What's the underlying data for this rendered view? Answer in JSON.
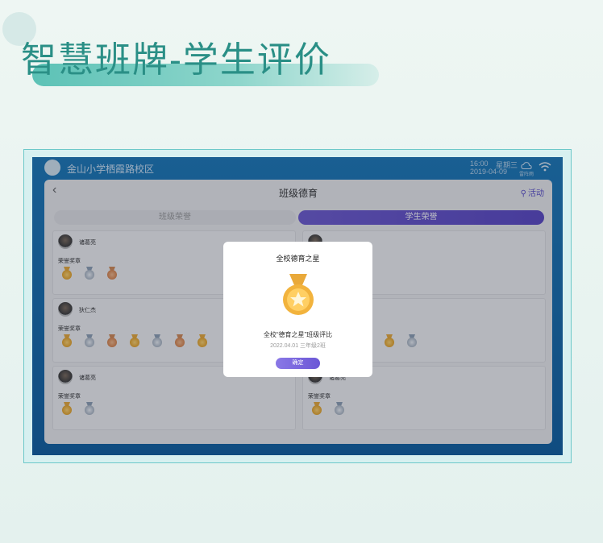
{
  "page": {
    "title": "智慧班牌-学生评价"
  },
  "topbar": {
    "school": "金山小学栖霞路校区",
    "time": "16:00",
    "date": "2019-04-09",
    "weekday": "星期三",
    "cloud_label": "雷阵雨"
  },
  "panel": {
    "title": "班级德育",
    "back_icon": "chevron-left",
    "activity_label": "活动",
    "tabs": [
      {
        "label": "班级荣誉",
        "active": false
      },
      {
        "label": "学生荣誉",
        "active": true
      }
    ]
  },
  "cards": [
    {
      "name": "诸葛亮",
      "label": "荣誉奖章",
      "medals": [
        "gold",
        "silver",
        "bronze"
      ]
    },
    {
      "name": "",
      "label": "",
      "medals": []
    },
    {
      "name": "狄仁杰",
      "label": "荣誉奖章",
      "medals": [
        "gold",
        "silver",
        "bronze",
        "gold",
        "silver",
        "bronze",
        "gold"
      ]
    },
    {
      "name": "",
      "label": "",
      "medals": [
        "gold",
        "silver"
      ]
    },
    {
      "name": "诸葛亮",
      "label": "荣誉奖章",
      "medals": [
        "gold",
        "silver"
      ]
    },
    {
      "name": "诸葛亮",
      "label": "荣誉奖章",
      "medals": [
        "gold",
        "silver"
      ]
    }
  ],
  "modal": {
    "title": "全校德育之星",
    "description": "全校“德育之星”班级评比",
    "subtitle": "2022.04.01 三年级2班",
    "confirm": "确定"
  },
  "colors": {
    "accent": "#6b57d6",
    "screen": "#1b79b9",
    "title": "#2a8f86"
  }
}
